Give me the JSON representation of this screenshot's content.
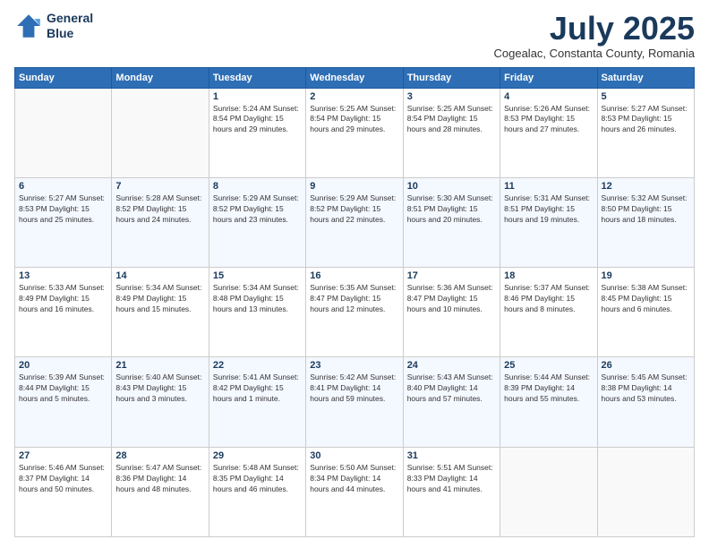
{
  "logo": {
    "line1": "General",
    "line2": "Blue"
  },
  "header": {
    "month": "July 2025",
    "location": "Cogealac, Constanta County, Romania"
  },
  "days_of_week": [
    "Sunday",
    "Monday",
    "Tuesday",
    "Wednesday",
    "Thursday",
    "Friday",
    "Saturday"
  ],
  "weeks": [
    [
      {
        "day": "",
        "info": ""
      },
      {
        "day": "",
        "info": ""
      },
      {
        "day": "1",
        "info": "Sunrise: 5:24 AM\nSunset: 8:54 PM\nDaylight: 15 hours\nand 29 minutes."
      },
      {
        "day": "2",
        "info": "Sunrise: 5:25 AM\nSunset: 8:54 PM\nDaylight: 15 hours\nand 29 minutes."
      },
      {
        "day": "3",
        "info": "Sunrise: 5:25 AM\nSunset: 8:54 PM\nDaylight: 15 hours\nand 28 minutes."
      },
      {
        "day": "4",
        "info": "Sunrise: 5:26 AM\nSunset: 8:53 PM\nDaylight: 15 hours\nand 27 minutes."
      },
      {
        "day": "5",
        "info": "Sunrise: 5:27 AM\nSunset: 8:53 PM\nDaylight: 15 hours\nand 26 minutes."
      }
    ],
    [
      {
        "day": "6",
        "info": "Sunrise: 5:27 AM\nSunset: 8:53 PM\nDaylight: 15 hours\nand 25 minutes."
      },
      {
        "day": "7",
        "info": "Sunrise: 5:28 AM\nSunset: 8:52 PM\nDaylight: 15 hours\nand 24 minutes."
      },
      {
        "day": "8",
        "info": "Sunrise: 5:29 AM\nSunset: 8:52 PM\nDaylight: 15 hours\nand 23 minutes."
      },
      {
        "day": "9",
        "info": "Sunrise: 5:29 AM\nSunset: 8:52 PM\nDaylight: 15 hours\nand 22 minutes."
      },
      {
        "day": "10",
        "info": "Sunrise: 5:30 AM\nSunset: 8:51 PM\nDaylight: 15 hours\nand 20 minutes."
      },
      {
        "day": "11",
        "info": "Sunrise: 5:31 AM\nSunset: 8:51 PM\nDaylight: 15 hours\nand 19 minutes."
      },
      {
        "day": "12",
        "info": "Sunrise: 5:32 AM\nSunset: 8:50 PM\nDaylight: 15 hours\nand 18 minutes."
      }
    ],
    [
      {
        "day": "13",
        "info": "Sunrise: 5:33 AM\nSunset: 8:49 PM\nDaylight: 15 hours\nand 16 minutes."
      },
      {
        "day": "14",
        "info": "Sunrise: 5:34 AM\nSunset: 8:49 PM\nDaylight: 15 hours\nand 15 minutes."
      },
      {
        "day": "15",
        "info": "Sunrise: 5:34 AM\nSunset: 8:48 PM\nDaylight: 15 hours\nand 13 minutes."
      },
      {
        "day": "16",
        "info": "Sunrise: 5:35 AM\nSunset: 8:47 PM\nDaylight: 15 hours\nand 12 minutes."
      },
      {
        "day": "17",
        "info": "Sunrise: 5:36 AM\nSunset: 8:47 PM\nDaylight: 15 hours\nand 10 minutes."
      },
      {
        "day": "18",
        "info": "Sunrise: 5:37 AM\nSunset: 8:46 PM\nDaylight: 15 hours\nand 8 minutes."
      },
      {
        "day": "19",
        "info": "Sunrise: 5:38 AM\nSunset: 8:45 PM\nDaylight: 15 hours\nand 6 minutes."
      }
    ],
    [
      {
        "day": "20",
        "info": "Sunrise: 5:39 AM\nSunset: 8:44 PM\nDaylight: 15 hours\nand 5 minutes."
      },
      {
        "day": "21",
        "info": "Sunrise: 5:40 AM\nSunset: 8:43 PM\nDaylight: 15 hours\nand 3 minutes."
      },
      {
        "day": "22",
        "info": "Sunrise: 5:41 AM\nSunset: 8:42 PM\nDaylight: 15 hours\nand 1 minute."
      },
      {
        "day": "23",
        "info": "Sunrise: 5:42 AM\nSunset: 8:41 PM\nDaylight: 14 hours\nand 59 minutes."
      },
      {
        "day": "24",
        "info": "Sunrise: 5:43 AM\nSunset: 8:40 PM\nDaylight: 14 hours\nand 57 minutes."
      },
      {
        "day": "25",
        "info": "Sunrise: 5:44 AM\nSunset: 8:39 PM\nDaylight: 14 hours\nand 55 minutes."
      },
      {
        "day": "26",
        "info": "Sunrise: 5:45 AM\nSunset: 8:38 PM\nDaylight: 14 hours\nand 53 minutes."
      }
    ],
    [
      {
        "day": "27",
        "info": "Sunrise: 5:46 AM\nSunset: 8:37 PM\nDaylight: 14 hours\nand 50 minutes."
      },
      {
        "day": "28",
        "info": "Sunrise: 5:47 AM\nSunset: 8:36 PM\nDaylight: 14 hours\nand 48 minutes."
      },
      {
        "day": "29",
        "info": "Sunrise: 5:48 AM\nSunset: 8:35 PM\nDaylight: 14 hours\nand 46 minutes."
      },
      {
        "day": "30",
        "info": "Sunrise: 5:50 AM\nSunset: 8:34 PM\nDaylight: 14 hours\nand 44 minutes."
      },
      {
        "day": "31",
        "info": "Sunrise: 5:51 AM\nSunset: 8:33 PM\nDaylight: 14 hours\nand 41 minutes."
      },
      {
        "day": "",
        "info": ""
      },
      {
        "day": "",
        "info": ""
      }
    ]
  ]
}
